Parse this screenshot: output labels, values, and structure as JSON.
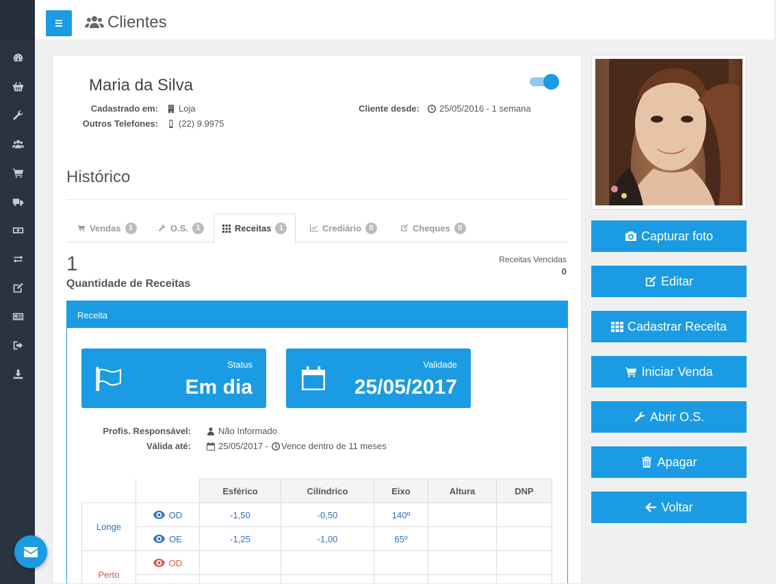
{
  "header": {
    "title": "Clientes"
  },
  "sidebar": {
    "items": [
      {
        "icon": "dashboard-icon"
      },
      {
        "icon": "basket-icon"
      },
      {
        "icon": "wrench-icon"
      },
      {
        "icon": "users-icon"
      },
      {
        "icon": "cart-icon"
      },
      {
        "icon": "truck-icon"
      },
      {
        "icon": "money-icon"
      },
      {
        "icon": "exchange-icon"
      },
      {
        "icon": "edit-icon"
      },
      {
        "icon": "newspaper-icon"
      },
      {
        "icon": "sign-out-icon"
      },
      {
        "icon": "download-icon"
      }
    ]
  },
  "client": {
    "name": "Maria da Silva",
    "registered_label": "Cadastrado em:",
    "registered_value": "Loja",
    "phones_label": "Outros Telefones:",
    "phones_value": "(22) 9.9975",
    "since_label": "Cliente desde:",
    "since_value": "25/05/2016 - 1 semana",
    "active": true
  },
  "history": {
    "title": "Histórico",
    "tabs": [
      {
        "label": "Vendas",
        "count": "1",
        "icon": "cart-icon"
      },
      {
        "label": "O.S.",
        "count": "1",
        "icon": "wrench-icon"
      },
      {
        "label": "Receitas",
        "count": "1",
        "icon": "grid-icon",
        "active": true
      },
      {
        "label": "Crediário",
        "count": "0",
        "icon": "chart-icon"
      },
      {
        "label": "Cheques",
        "count": "0",
        "icon": "edit-icon"
      }
    ],
    "count_value": "1",
    "count_label": "Quantidade de Receitas",
    "expired_label": "Receitas Vencidas",
    "expired_value": "0"
  },
  "receita": {
    "panel_title": "Receita",
    "status_label": "Status",
    "status_value": "Em dia",
    "validity_label": "Validade",
    "validity_value": "25/05/2017",
    "professional_label": "Profis. Responsável:",
    "professional_value": "Não Informado",
    "valid_until_label": "Válida até:",
    "valid_until_date": "25/05/2017 -",
    "valid_until_note": "Vence dentro de 11 meses",
    "table": {
      "headers": [
        "Esférico",
        "Cilíndrico",
        "Eixo",
        "Altura",
        "DNP"
      ],
      "longe_label": "Longe",
      "perto_label": "Perto",
      "rows": [
        {
          "eye": "OD",
          "esferico": "-1,50",
          "cilindrico": "-0,50",
          "eixo": "140º",
          "altura": "",
          "dnp": ""
        },
        {
          "eye": "OE",
          "esferico": "-1,25",
          "cilindrico": "-1,00",
          "eixo": "65º",
          "altura": "",
          "dnp": ""
        },
        {
          "eye": "OD",
          "esferico": "",
          "cilindrico": "",
          "eixo": "",
          "altura": "",
          "dnp": ""
        },
        {
          "eye": "",
          "esferico": "",
          "cilindrico": "",
          "eixo": "",
          "altura": "",
          "dnp": ""
        }
      ]
    }
  },
  "actions": {
    "capture_photo": "Capturar foto",
    "edit": "Editar",
    "register_prescription": "Cadastrar Receita",
    "start_sale": "Iniciar Venda",
    "open_os": "Abrir O.S.",
    "delete": "Apagar",
    "back": "Voltar"
  },
  "colors": {
    "primary": "#1a9be3",
    "sidebar": "#2a3441",
    "near_eye": "#d9534f",
    "far_eye": "#2a6fb8"
  }
}
